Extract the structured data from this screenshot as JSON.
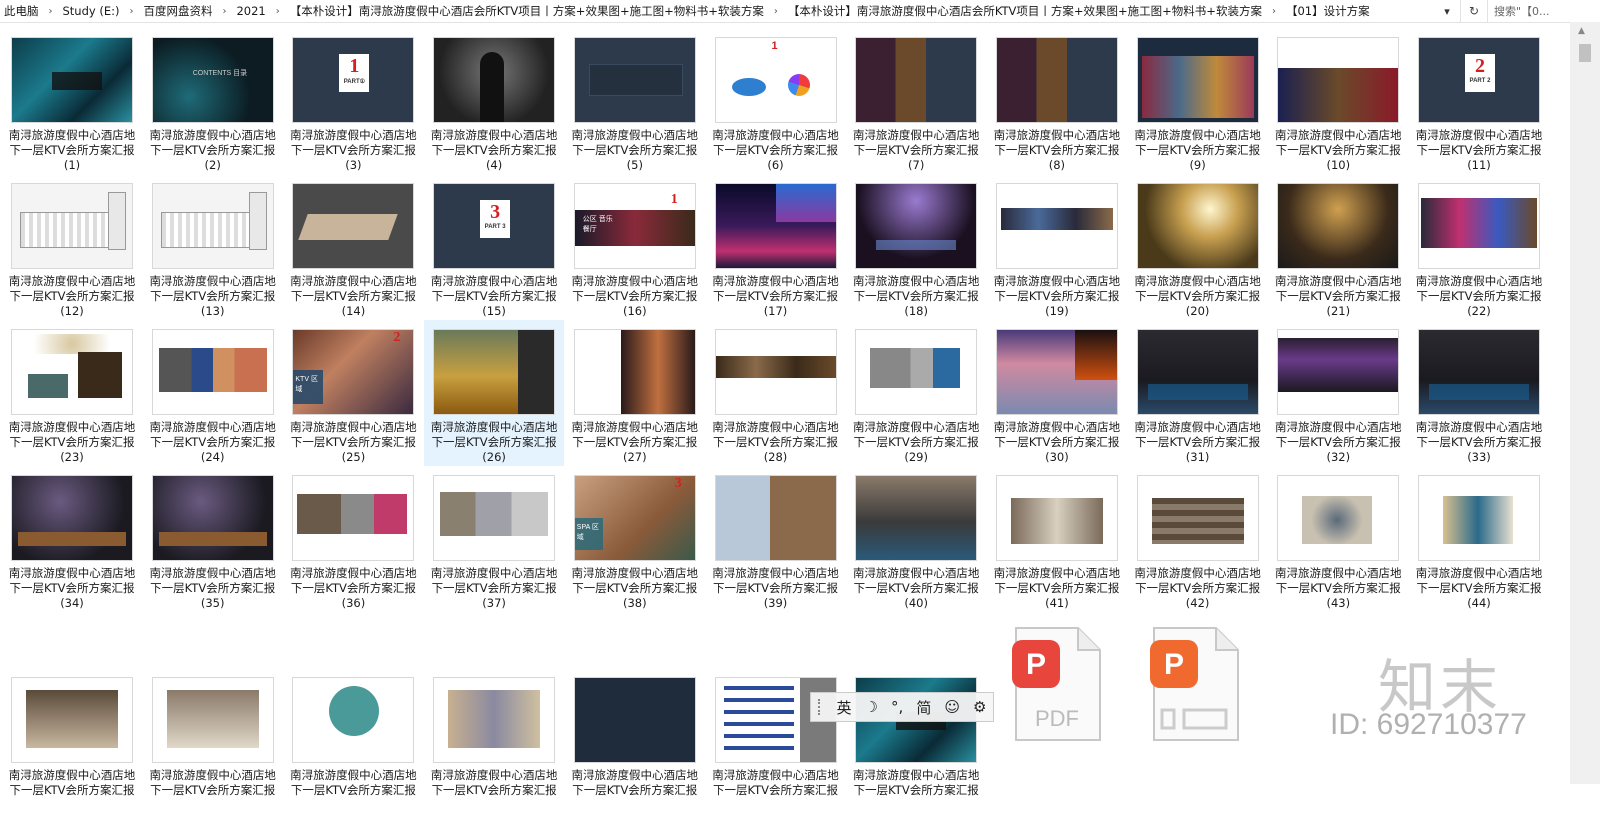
{
  "addressbar": {
    "crumbs": [
      "此电脑",
      "Study (E:)",
      "百度网盘资料",
      "2021",
      "【本朴设计】南浔旅游度假中心酒店会所KTV项目丨方案+效果图+施工图+物料书+软装方案",
      "【本朴设计】南浔旅游度假中心酒店会所KTV项目丨方案+效果图+施工图+物料书+软装方案",
      "【01】设计方案"
    ],
    "separator": "›",
    "dropdown_icon": "chevron-down-icon",
    "refresh_icon": "refresh-icon",
    "search_placeholder": "搜索\"【0..."
  },
  "caption_prefix_line1": "南浔旅游度假中心酒店地",
  "caption_prefix_line2": "下一层KTV会所方案汇报",
  "files": [
    {
      "num": "(1)",
      "theme": "teal-silk"
    },
    {
      "num": "(2)",
      "theme": "contents"
    },
    {
      "num": "(3)",
      "theme": "part1"
    },
    {
      "num": "(4)",
      "theme": "singer"
    },
    {
      "num": "(5)",
      "theme": "navy-text"
    },
    {
      "num": "(6)",
      "theme": "pie-chart"
    },
    {
      "num": "(7)",
      "theme": "collage-dark"
    },
    {
      "num": "(8)",
      "theme": "collage-dark"
    },
    {
      "num": "(9)",
      "theme": "collage-blue"
    },
    {
      "num": "(10)",
      "theme": "night-sky"
    },
    {
      "num": "(11)",
      "theme": "part2"
    },
    {
      "num": "(12)",
      "theme": "floorplan"
    },
    {
      "num": "(13)",
      "theme": "floorplan"
    },
    {
      "num": "(14)",
      "theme": "model"
    },
    {
      "num": "(15)",
      "theme": "part3"
    },
    {
      "num": "(16)",
      "theme": "music-hall"
    },
    {
      "num": "(17)",
      "theme": "neon-city"
    },
    {
      "num": "(18)",
      "theme": "purple-hall"
    },
    {
      "num": "(19)",
      "theme": "elevation"
    },
    {
      "num": "(20)",
      "theme": "sunlight"
    },
    {
      "num": "(21)",
      "theme": "gold-hall"
    },
    {
      "num": "(22)",
      "theme": "bar-elevation"
    },
    {
      "num": "(23)",
      "theme": "chandelier"
    },
    {
      "num": "(24)",
      "theme": "materials"
    },
    {
      "num": "(25)",
      "theme": "ktv-party"
    },
    {
      "num": "(26)",
      "theme": "golden-path"
    },
    {
      "num": "(27)",
      "theme": "corridor"
    },
    {
      "num": "(28)",
      "theme": "strip"
    },
    {
      "num": "(29)",
      "theme": "materials-grey"
    },
    {
      "num": "(30)",
      "theme": "ice-sunset"
    },
    {
      "num": "(31)",
      "theme": "dark-lounge"
    },
    {
      "num": "(32)",
      "theme": "dark-lounge-white"
    },
    {
      "num": "(33)",
      "theme": "dark-lounge"
    },
    {
      "num": "(34)",
      "theme": "ktv-room"
    },
    {
      "num": "(35)",
      "theme": "ktv-room"
    },
    {
      "num": "(36)",
      "theme": "room-collage"
    },
    {
      "num": "(37)",
      "theme": "stone-samples"
    },
    {
      "num": "(38)",
      "theme": "spa"
    },
    {
      "num": "(39)",
      "theme": "spa-collage"
    },
    {
      "num": "(40)",
      "theme": "spa-room"
    },
    {
      "num": "(41)",
      "theme": "small-render"
    },
    {
      "num": "(42)",
      "theme": "small-shelf"
    },
    {
      "num": "(43)",
      "theme": "small-mirror"
    },
    {
      "num": "(44)",
      "theme": "small-marble"
    },
    {
      "num": "",
      "theme": "small-bath"
    },
    {
      "num": "",
      "theme": "small-bath2"
    },
    {
      "num": "",
      "theme": "small-teal"
    },
    {
      "num": "",
      "theme": "small-wood"
    },
    {
      "num": "",
      "theme": "navy-blank"
    },
    {
      "num": "",
      "theme": "logos"
    },
    {
      "num": "",
      "theme": "teal-silk2"
    }
  ],
  "big_numbers": {
    "part1": "1",
    "part2": "2",
    "part3": "3",
    "sec1": "1",
    "sec2": "2",
    "sec3": "3",
    "pie": "1"
  },
  "thumb_text": {
    "contents": "CONTENTS 目录",
    "part1_label": "PART①",
    "part2_label": "PART 2",
    "part3_label": "PART 3",
    "music_hall": "公区 音乐餐厅",
    "ktv_zone": "KTV 区域",
    "spa_zone": "SPA 区域"
  },
  "pdf_icons": [
    {
      "label": "PDF",
      "glyph": "P"
    },
    {
      "label": "",
      "glyph": "P"
    }
  ],
  "ime_toolbar": {
    "lang": "英",
    "moon": "☽",
    "punct": "°,",
    "mode": "简",
    "emoji": "☺",
    "gear": "⚙"
  },
  "watermark": {
    "logo": "知末",
    "id": "ID: 692710377"
  },
  "colors": {
    "accent": "#0078d7",
    "navy": "#2d3a4c",
    "red": "#d42020",
    "pdf_red": "#e8463c",
    "ppt_orange": "#f06a30"
  }
}
